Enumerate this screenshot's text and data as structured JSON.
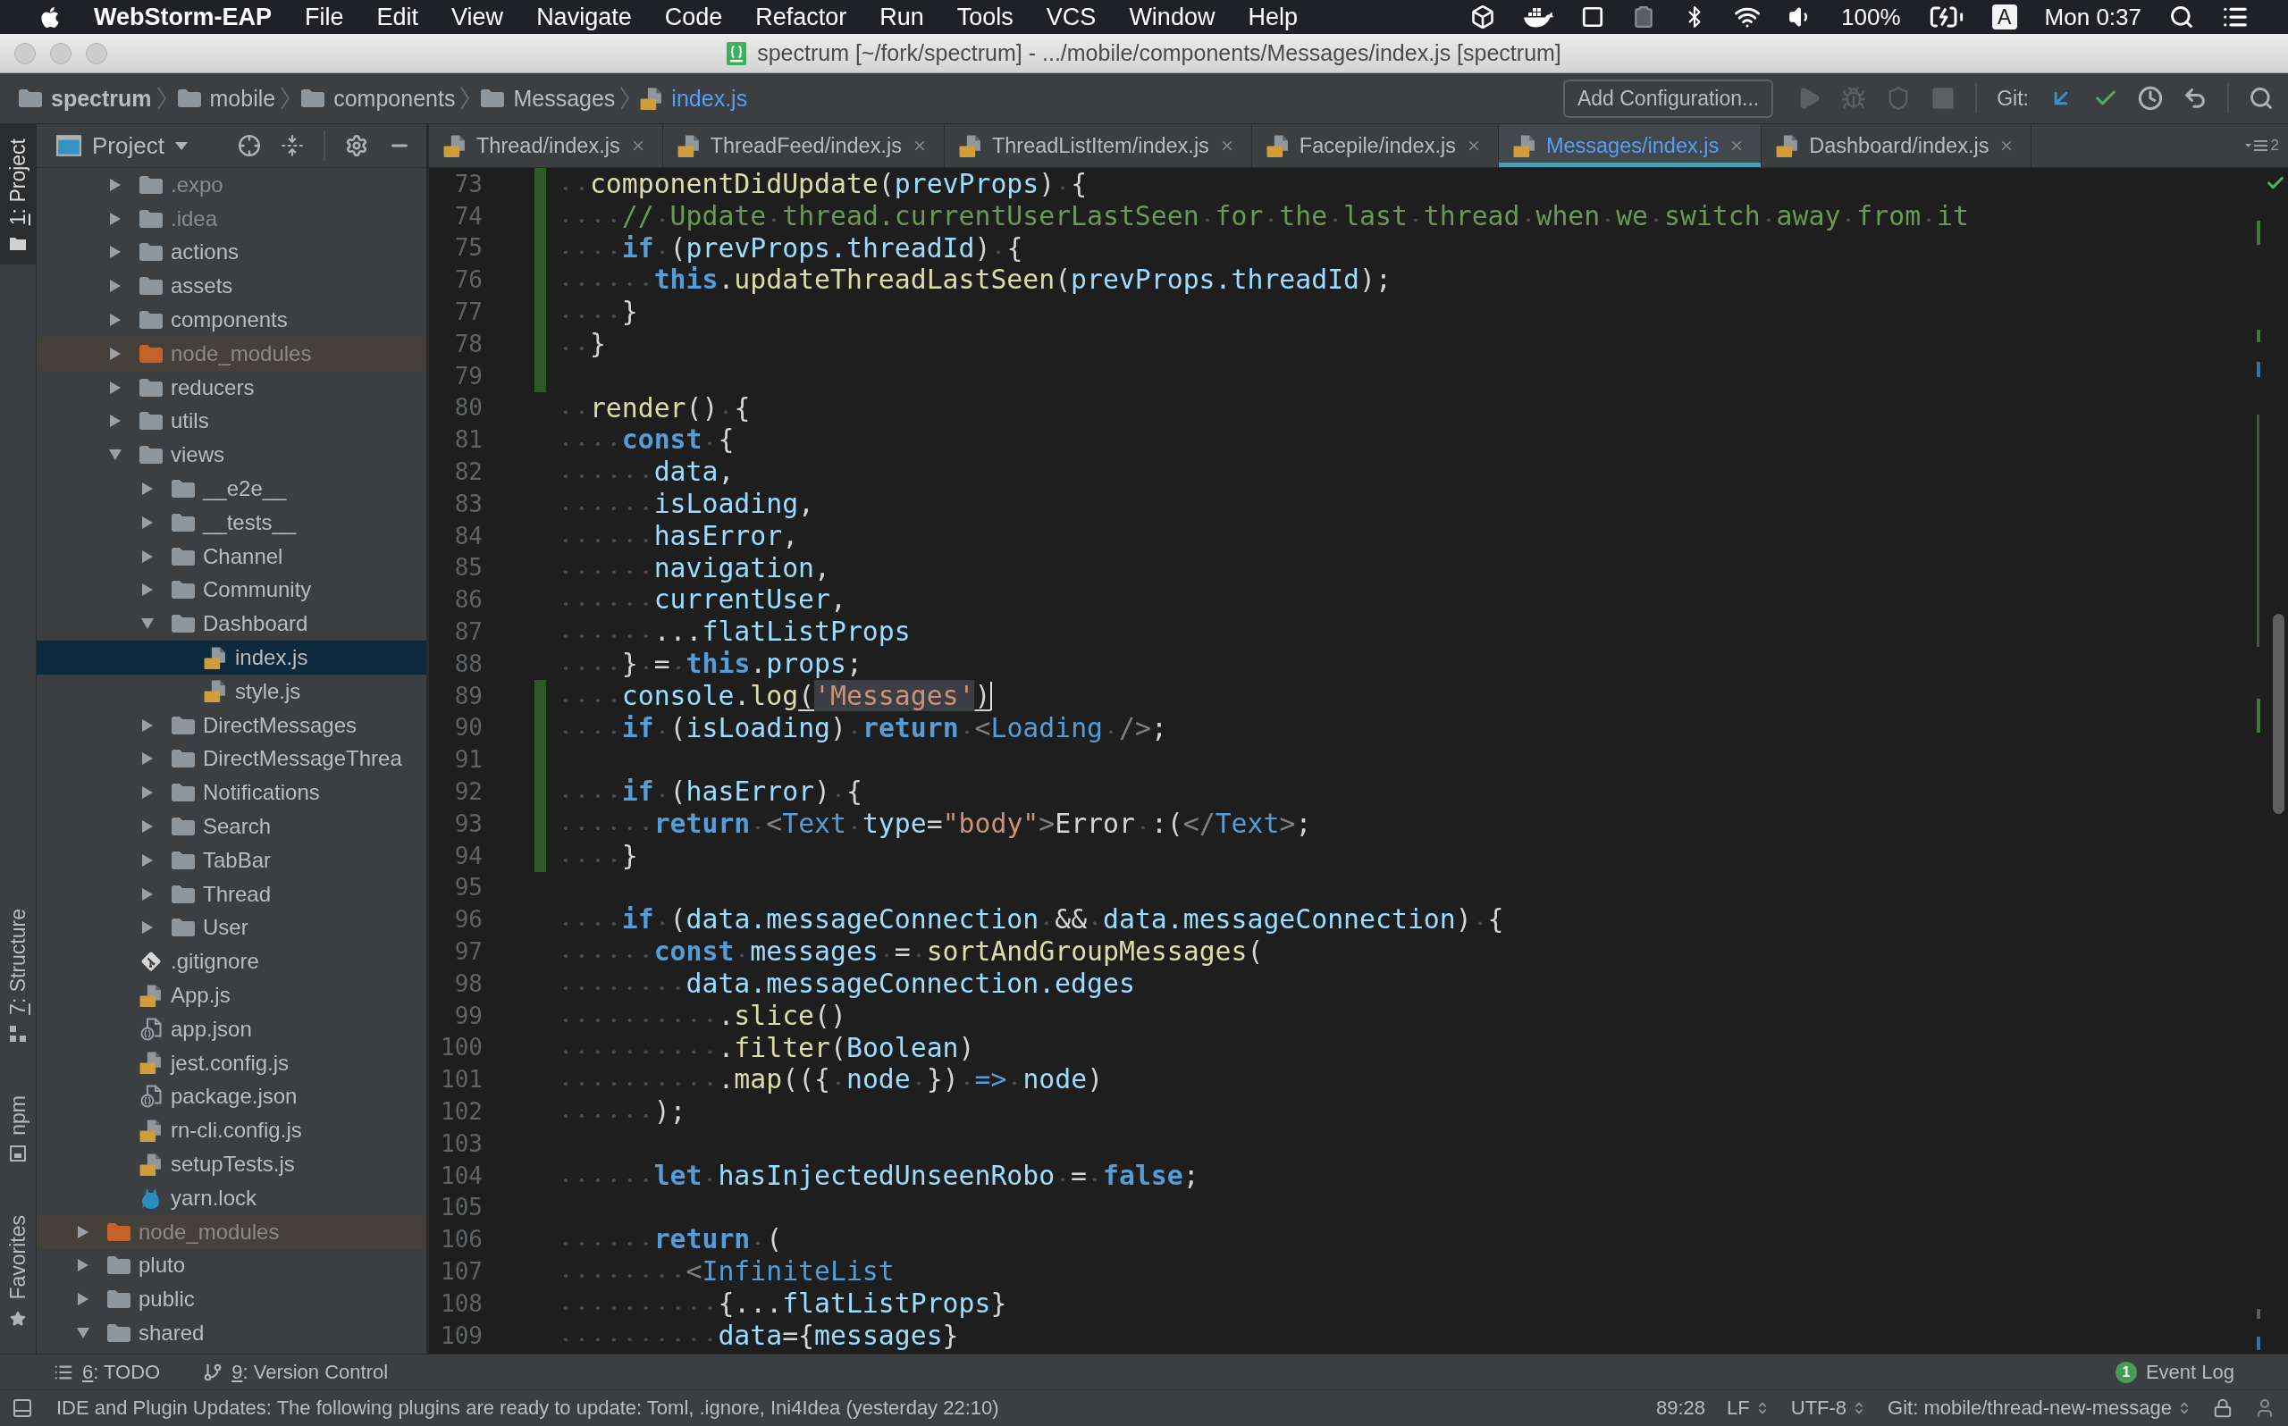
{
  "menu_bar": {
    "app_name": "WebStorm-EAP",
    "menus": [
      "File",
      "Edit",
      "View",
      "Navigate",
      "Code",
      "Refactor",
      "Run",
      "Tools",
      "VCS",
      "Window",
      "Help"
    ],
    "battery": "100%",
    "input_source": "A",
    "clock": "Mon 0:37"
  },
  "window": {
    "title": "spectrum [~/fork/spectrum] - .../mobile/components/Messages/index.js [spectrum]"
  },
  "navigation_bar": {
    "breadcrumbs": [
      {
        "label": "spectrum",
        "kind": "project"
      },
      {
        "label": "mobile",
        "kind": "folder"
      },
      {
        "label": "components",
        "kind": "folder"
      },
      {
        "label": "Messages",
        "kind": "folder"
      },
      {
        "label": "index.js",
        "kind": "file"
      }
    ],
    "configuration_button": "Add Configuration...",
    "run_actions": [
      {
        "kind": "run",
        "disabled": true
      },
      {
        "kind": "debug",
        "disabled": true
      },
      {
        "kind": "coverage",
        "disabled": true
      },
      {
        "kind": "stop",
        "disabled": true
      }
    ],
    "vcs_label": "Git:",
    "vcs_actions": [
      {
        "kind": "update"
      },
      {
        "kind": "commit"
      },
      {
        "kind": "history"
      },
      {
        "kind": "revert"
      }
    ]
  },
  "tool_strip": {
    "top": [
      {
        "label": "1: Project",
        "selected": true,
        "mnemonic": true
      }
    ],
    "bottom": [
      {
        "label": "7: Structure",
        "selected": false,
        "mnemonic": true
      },
      {
        "label": "npm",
        "selected": false,
        "mnemonic": false
      },
      {
        "label": "Favorites",
        "selected": false,
        "mnemonic": false
      }
    ]
  },
  "project_panel": {
    "title": "Project",
    "tree": [
      {
        "children": [
          {
            "label": ".expo",
            "kind": "folder",
            "expanded": false,
            "selected": false,
            "ignored": true
          },
          {
            "label": ".idea",
            "kind": "folder",
            "expanded": false,
            "selected": false,
            "ignored": true
          },
          {
            "label": "actions",
            "kind": "folder",
            "expanded": false,
            "selected": false,
            "ignored": false
          },
          {
            "label": "assets",
            "kind": "folder",
            "expanded": false,
            "selected": false,
            "ignored": false
          },
          {
            "label": "components",
            "kind": "folder",
            "expanded": false,
            "selected": false,
            "ignored": false
          },
          {
            "label": "node_modules",
            "kind": "excluded_folder",
            "expanded": false,
            "selected": false,
            "ignored": true
          },
          {
            "label": "reducers",
            "kind": "folder",
            "expanded": false,
            "selected": false,
            "ignored": false
          },
          {
            "label": "utils",
            "kind": "folder",
            "expanded": false,
            "selected": false,
            "ignored": false
          },
          {
            "label": "views",
            "kind": "folder",
            "expanded": true,
            "selected": false,
            "ignored": false,
            "children": [
              {
                "label": "__e2e__",
                "kind": "folder",
                "expanded": false,
                "selected": false,
                "ignored": false
              },
              {
                "label": "__tests__",
                "kind": "folder",
                "expanded": false,
                "selected": false,
                "ignored": false
              },
              {
                "label": "Channel",
                "kind": "folder",
                "expanded": false,
                "selected": false,
                "ignored": false
              },
              {
                "label": "Community",
                "kind": "folder",
                "expanded": false,
                "selected": false,
                "ignored": false
              },
              {
                "label": "Dashboard",
                "kind": "folder",
                "expanded": true,
                "selected": false,
                "ignored": false,
                "children": [
                  {
                    "label": "index.js",
                    "kind": "js_file",
                    "selected": true,
                    "ignored": false
                  },
                  {
                    "label": "style.js",
                    "kind": "js_file",
                    "selected": false,
                    "ignored": false
                  }
                ]
              },
              {
                "label": "DirectMessages",
                "kind": "folder",
                "expanded": false,
                "selected": false,
                "ignored": false
              },
              {
                "label": "DirectMessageThrea",
                "kind": "folder",
                "expanded": false,
                "selected": false,
                "ignored": false
              },
              {
                "label": "Notifications",
                "kind": "folder",
                "expanded": false,
                "selected": false,
                "ignored": false
              },
              {
                "label": "Search",
                "kind": "folder",
                "expanded": false,
                "selected": false,
                "ignored": false
              },
              {
                "label": "TabBar",
                "kind": "folder",
                "expanded": false,
                "selected": false,
                "ignored": false
              },
              {
                "label": "Thread",
                "kind": "folder",
                "expanded": false,
                "selected": false,
                "ignored": false
              },
              {
                "label": "User",
                "kind": "folder",
                "expanded": false,
                "selected": false,
                "ignored": false
              }
            ]
          },
          {
            "label": ".gitignore",
            "kind": "git_file",
            "selected": false,
            "ignored": false
          },
          {
            "label": "App.js",
            "kind": "js_file",
            "selected": false,
            "ignored": false
          },
          {
            "label": "app.json",
            "kind": "json_file",
            "selected": false,
            "ignored": false
          },
          {
            "label": "jest.config.js",
            "kind": "js_file",
            "selected": false,
            "ignored": false
          },
          {
            "label": "package.json",
            "kind": "json_file",
            "selected": false,
            "ignored": false
          },
          {
            "label": "rn-cli.config.js",
            "kind": "js_file",
            "selected": false,
            "ignored": false
          },
          {
            "label": "setupTests.js",
            "kind": "js_file",
            "selected": false,
            "ignored": false
          },
          {
            "label": "yarn.lock",
            "kind": "yarn_file",
            "selected": false,
            "ignored": false
          }
        ]
      },
      {
        "label": "node_modules",
        "kind": "excluded_folder",
        "expanded": false,
        "selected": false,
        "ignored": true
      },
      {
        "label": "pluto",
        "kind": "folder",
        "expanded": false,
        "selected": false,
        "ignored": false
      },
      {
        "label": "public",
        "kind": "folder",
        "expanded": false,
        "selected": false,
        "ignored": false
      },
      {
        "label": "shared",
        "kind": "folder",
        "expanded": true,
        "selected": false,
        "ignored": false
      }
    ]
  },
  "editor": {
    "tabs": [
      {
        "label": "Thread/index.js",
        "selected": false
      },
      {
        "label": "ThreadFeed/index.js",
        "selected": false
      },
      {
        "label": "ThreadListItem/index.js",
        "selected": false
      },
      {
        "label": "Facepile/index.js",
        "selected": false
      },
      {
        "label": "Messages/index.js",
        "selected": true
      },
      {
        "label": "Dashboard/index.js",
        "selected": false
      }
    ],
    "hidden_tab_count": "2",
    "lines": [
      {
        "number": "73",
        "modified": true,
        "caret": false,
        "tokens": [
          {
            "kind": "function",
            "text": "  componentDidUpdate"
          },
          {
            "kind": "plain",
            "text": "("
          },
          {
            "kind": "variable",
            "text": "prevProps"
          },
          {
            "kind": "plain",
            "text": ") {"
          }
        ]
      },
      {
        "number": "74",
        "modified": true,
        "caret": false,
        "tokens": [
          {
            "kind": "comment",
            "text": "    // Update thread.currentUserLastSeen for the last thread when we switch away from it"
          }
        ]
      },
      {
        "number": "75",
        "modified": true,
        "caret": false,
        "tokens": [
          {
            "kind": "keyword",
            "text": "    if"
          },
          {
            "kind": "plain",
            "text": " ("
          },
          {
            "kind": "variable",
            "text": "prevProps.threadId"
          },
          {
            "kind": "plain",
            "text": ") {"
          }
        ]
      },
      {
        "number": "76",
        "modified": true,
        "caret": false,
        "tokens": [
          {
            "kind": "keyword",
            "text": "      this"
          },
          {
            "kind": "plain",
            "text": "."
          },
          {
            "kind": "function",
            "text": "updateThreadLastSeen"
          },
          {
            "kind": "plain",
            "text": "("
          },
          {
            "kind": "variable",
            "text": "prevProps.threadId"
          },
          {
            "kind": "plain",
            "text": ");"
          }
        ]
      },
      {
        "number": "77",
        "modified": true,
        "caret": false,
        "tokens": [
          {
            "kind": "plain",
            "text": "    }"
          }
        ]
      },
      {
        "number": "78",
        "modified": true,
        "caret": false,
        "tokens": [
          {
            "kind": "plain",
            "text": "  }"
          }
        ]
      },
      {
        "number": "79",
        "modified": true,
        "caret": false
      },
      {
        "number": "80",
        "modified": false,
        "caret": false,
        "tokens": [
          {
            "kind": "function",
            "text": "  render"
          },
          {
            "kind": "plain",
            "text": "() {"
          }
        ]
      },
      {
        "number": "81",
        "modified": false,
        "caret": false,
        "tokens": [
          {
            "kind": "keyword",
            "text": "    const"
          },
          {
            "kind": "plain",
            "text": " {"
          }
        ]
      },
      {
        "number": "82",
        "modified": false,
        "caret": false,
        "tokens": [
          {
            "kind": "variable",
            "text": "      data"
          },
          {
            "kind": "plain",
            "text": ","
          }
        ]
      },
      {
        "number": "83",
        "modified": false,
        "caret": false,
        "tokens": [
          {
            "kind": "variable",
            "text": "      isLoading"
          },
          {
            "kind": "plain",
            "text": ","
          }
        ]
      },
      {
        "number": "84",
        "modified": false,
        "caret": false,
        "tokens": [
          {
            "kind": "variable",
            "text": "      hasError"
          },
          {
            "kind": "plain",
            "text": ","
          }
        ]
      },
      {
        "number": "85",
        "modified": false,
        "caret": false,
        "tokens": [
          {
            "kind": "variable",
            "text": "      navigation"
          },
          {
            "kind": "plain",
            "text": ","
          }
        ]
      },
      {
        "number": "86",
        "modified": false,
        "caret": false,
        "tokens": [
          {
            "kind": "variable",
            "text": "      currentUser"
          },
          {
            "kind": "plain",
            "text": ","
          }
        ]
      },
      {
        "number": "87",
        "modified": false,
        "caret": false,
        "tokens": [
          {
            "kind": "plain",
            "text": "      ..."
          },
          {
            "kind": "variable",
            "text": "flatListProps"
          }
        ]
      },
      {
        "number": "88",
        "modified": false,
        "caret": false,
        "tokens": [
          {
            "kind": "plain",
            "text": "    } = "
          },
          {
            "kind": "keyword",
            "text": "this"
          },
          {
            "kind": "plain",
            "text": "."
          },
          {
            "kind": "variable",
            "text": "props"
          },
          {
            "kind": "plain",
            "text": ";"
          }
        ]
      },
      {
        "number": "89",
        "modified": true,
        "caret": true,
        "tokens": [
          {
            "kind": "variable",
            "text": "    console"
          },
          {
            "kind": "plain",
            "text": "."
          },
          {
            "kind": "function",
            "text": "log"
          },
          {
            "kind": "matched_brace",
            "text": "("
          },
          {
            "kind": "highlight_string",
            "text": "'Messages'"
          },
          {
            "kind": "matched_brace",
            "text": ")"
          }
        ]
      },
      {
        "number": "90",
        "modified": true,
        "caret": false,
        "tokens": [
          {
            "kind": "keyword",
            "text": "    if"
          },
          {
            "kind": "plain",
            "text": " ("
          },
          {
            "kind": "variable",
            "text": "isLoading"
          },
          {
            "kind": "plain",
            "text": ") "
          },
          {
            "kind": "keyword",
            "text": "return"
          },
          {
            "kind": "bracket",
            "text": " <"
          },
          {
            "kind": "tag",
            "text": "Loading"
          },
          {
            "kind": "bracket",
            "text": " />"
          },
          {
            "kind": "plain",
            "text": ";"
          }
        ]
      },
      {
        "number": "91",
        "modified": true,
        "caret": false
      },
      {
        "number": "92",
        "modified": true,
        "caret": false,
        "tokens": [
          {
            "kind": "keyword",
            "text": "    if"
          },
          {
            "kind": "plain",
            "text": " ("
          },
          {
            "kind": "variable",
            "text": "hasError"
          },
          {
            "kind": "plain",
            "text": ") {"
          }
        ]
      },
      {
        "number": "93",
        "modified": true,
        "caret": false,
        "tokens": [
          {
            "kind": "keyword",
            "text": "      return"
          },
          {
            "kind": "bracket",
            "text": " <"
          },
          {
            "kind": "tag",
            "text": "Text"
          },
          {
            "kind": "variable",
            "text": " type"
          },
          {
            "kind": "plain",
            "text": "="
          },
          {
            "kind": "string",
            "text": "\"body\""
          },
          {
            "kind": "bracket",
            "text": ">"
          },
          {
            "kind": "plain",
            "text": "Error :("
          },
          {
            "kind": "bracket",
            "text": "</"
          },
          {
            "kind": "tag",
            "text": "Text"
          },
          {
            "kind": "bracket",
            "text": ">"
          },
          {
            "kind": "plain",
            "text": ";"
          }
        ]
      },
      {
        "number": "94",
        "modified": true,
        "caret": false,
        "tokens": [
          {
            "kind": "plain",
            "text": "    }"
          }
        ]
      },
      {
        "number": "95",
        "modified": false,
        "caret": false
      },
      {
        "number": "96",
        "modified": false,
        "caret": false,
        "tokens": [
          {
            "kind": "keyword",
            "text": "    if"
          },
          {
            "kind": "plain",
            "text": " ("
          },
          {
            "kind": "variable",
            "text": "data.messageConnection"
          },
          {
            "kind": "plain",
            "text": " && "
          },
          {
            "kind": "variable",
            "text": "data.messageConnection"
          },
          {
            "kind": "plain",
            "text": ") {"
          }
        ]
      },
      {
        "number": "97",
        "modified": false,
        "caret": false,
        "tokens": [
          {
            "kind": "keyword",
            "text": "      const"
          },
          {
            "kind": "variable",
            "text": " messages"
          },
          {
            "kind": "plain",
            "text": " = "
          },
          {
            "kind": "function",
            "text": "sortAndGroupMessages"
          },
          {
            "kind": "plain",
            "text": "("
          }
        ]
      },
      {
        "number": "98",
        "modified": false,
        "caret": false,
        "tokens": [
          {
            "kind": "variable",
            "text": "        data.messageConnection.edges"
          }
        ]
      },
      {
        "number": "99",
        "modified": false,
        "caret": false,
        "tokens": [
          {
            "kind": "plain",
            "text": "          ."
          },
          {
            "kind": "function",
            "text": "slice"
          },
          {
            "kind": "plain",
            "text": "()"
          }
        ]
      },
      {
        "number": "100",
        "modified": false,
        "caret": false,
        "tokens": [
          {
            "kind": "plain",
            "text": "          ."
          },
          {
            "kind": "function",
            "text": "filter"
          },
          {
            "kind": "plain",
            "text": "("
          },
          {
            "kind": "variable",
            "text": "Boolean"
          },
          {
            "kind": "plain",
            "text": ")"
          }
        ]
      },
      {
        "number": "101",
        "modified": false,
        "caret": false,
        "tokens": [
          {
            "kind": "plain",
            "text": "          ."
          },
          {
            "kind": "function",
            "text": "map"
          },
          {
            "kind": "plain",
            "text": "(({ "
          },
          {
            "kind": "variable",
            "text": "node"
          },
          {
            "kind": "plain",
            "text": " }) "
          },
          {
            "kind": "operator",
            "text": "=>"
          },
          {
            "kind": "variable",
            "text": " node"
          },
          {
            "kind": "plain",
            "text": ")"
          }
        ]
      },
      {
        "number": "102",
        "modified": false,
        "caret": false,
        "tokens": [
          {
            "kind": "plain",
            "text": "      );"
          }
        ]
      },
      {
        "number": "103",
        "modified": false,
        "caret": false
      },
      {
        "number": "104",
        "modified": false,
        "caret": false,
        "tokens": [
          {
            "kind": "keyword",
            "text": "      let"
          },
          {
            "kind": "variable",
            "text": " hasInjectedUnseenRobo"
          },
          {
            "kind": "plain",
            "text": " = "
          },
          {
            "kind": "keyword",
            "text": "false"
          },
          {
            "kind": "plain",
            "text": ";"
          }
        ]
      },
      {
        "number": "105",
        "modified": false,
        "caret": false
      },
      {
        "number": "106",
        "modified": false,
        "caret": false,
        "tokens": [
          {
            "kind": "keyword",
            "text": "      return"
          },
          {
            "kind": "plain",
            "text": " ("
          }
        ]
      },
      {
        "number": "107",
        "modified": false,
        "caret": false,
        "tokens": [
          {
            "kind": "bracket",
            "text": "        <"
          },
          {
            "kind": "tag",
            "text": "InfiniteList"
          }
        ]
      },
      {
        "number": "108",
        "modified": false,
        "caret": false,
        "tokens": [
          {
            "kind": "plain",
            "text": "          {..."
          },
          {
            "kind": "variable",
            "text": "flatListProps"
          },
          {
            "kind": "plain",
            "text": "}"
          }
        ]
      },
      {
        "number": "109",
        "modified": false,
        "caret": false,
        "tokens": [
          {
            "kind": "variable",
            "text": "          data"
          },
          {
            "kind": "plain",
            "text": "={"
          },
          {
            "kind": "variable",
            "text": "messages"
          },
          {
            "kind": "plain",
            "text": "}"
          }
        ]
      }
    ]
  },
  "bottom_tool_bar": {
    "tools": [
      {
        "label": "6: TODO",
        "kind": "todo",
        "mnemonic": true
      },
      {
        "label": "9: Version Control",
        "kind": "version_control",
        "mnemonic": true
      }
    ],
    "event_log": {
      "label": "Event Log",
      "count": "1"
    }
  },
  "status_bar": {
    "message": "IDE and Plugin Updates: The following plugins are ready to update: Toml, .ignore, Ini4Idea (yesterday 22:10)",
    "caret_position": "89:28",
    "line_separator": "LF",
    "encoding": "UTF-8",
    "branch": "Git: mobile/thread-new-message"
  }
}
